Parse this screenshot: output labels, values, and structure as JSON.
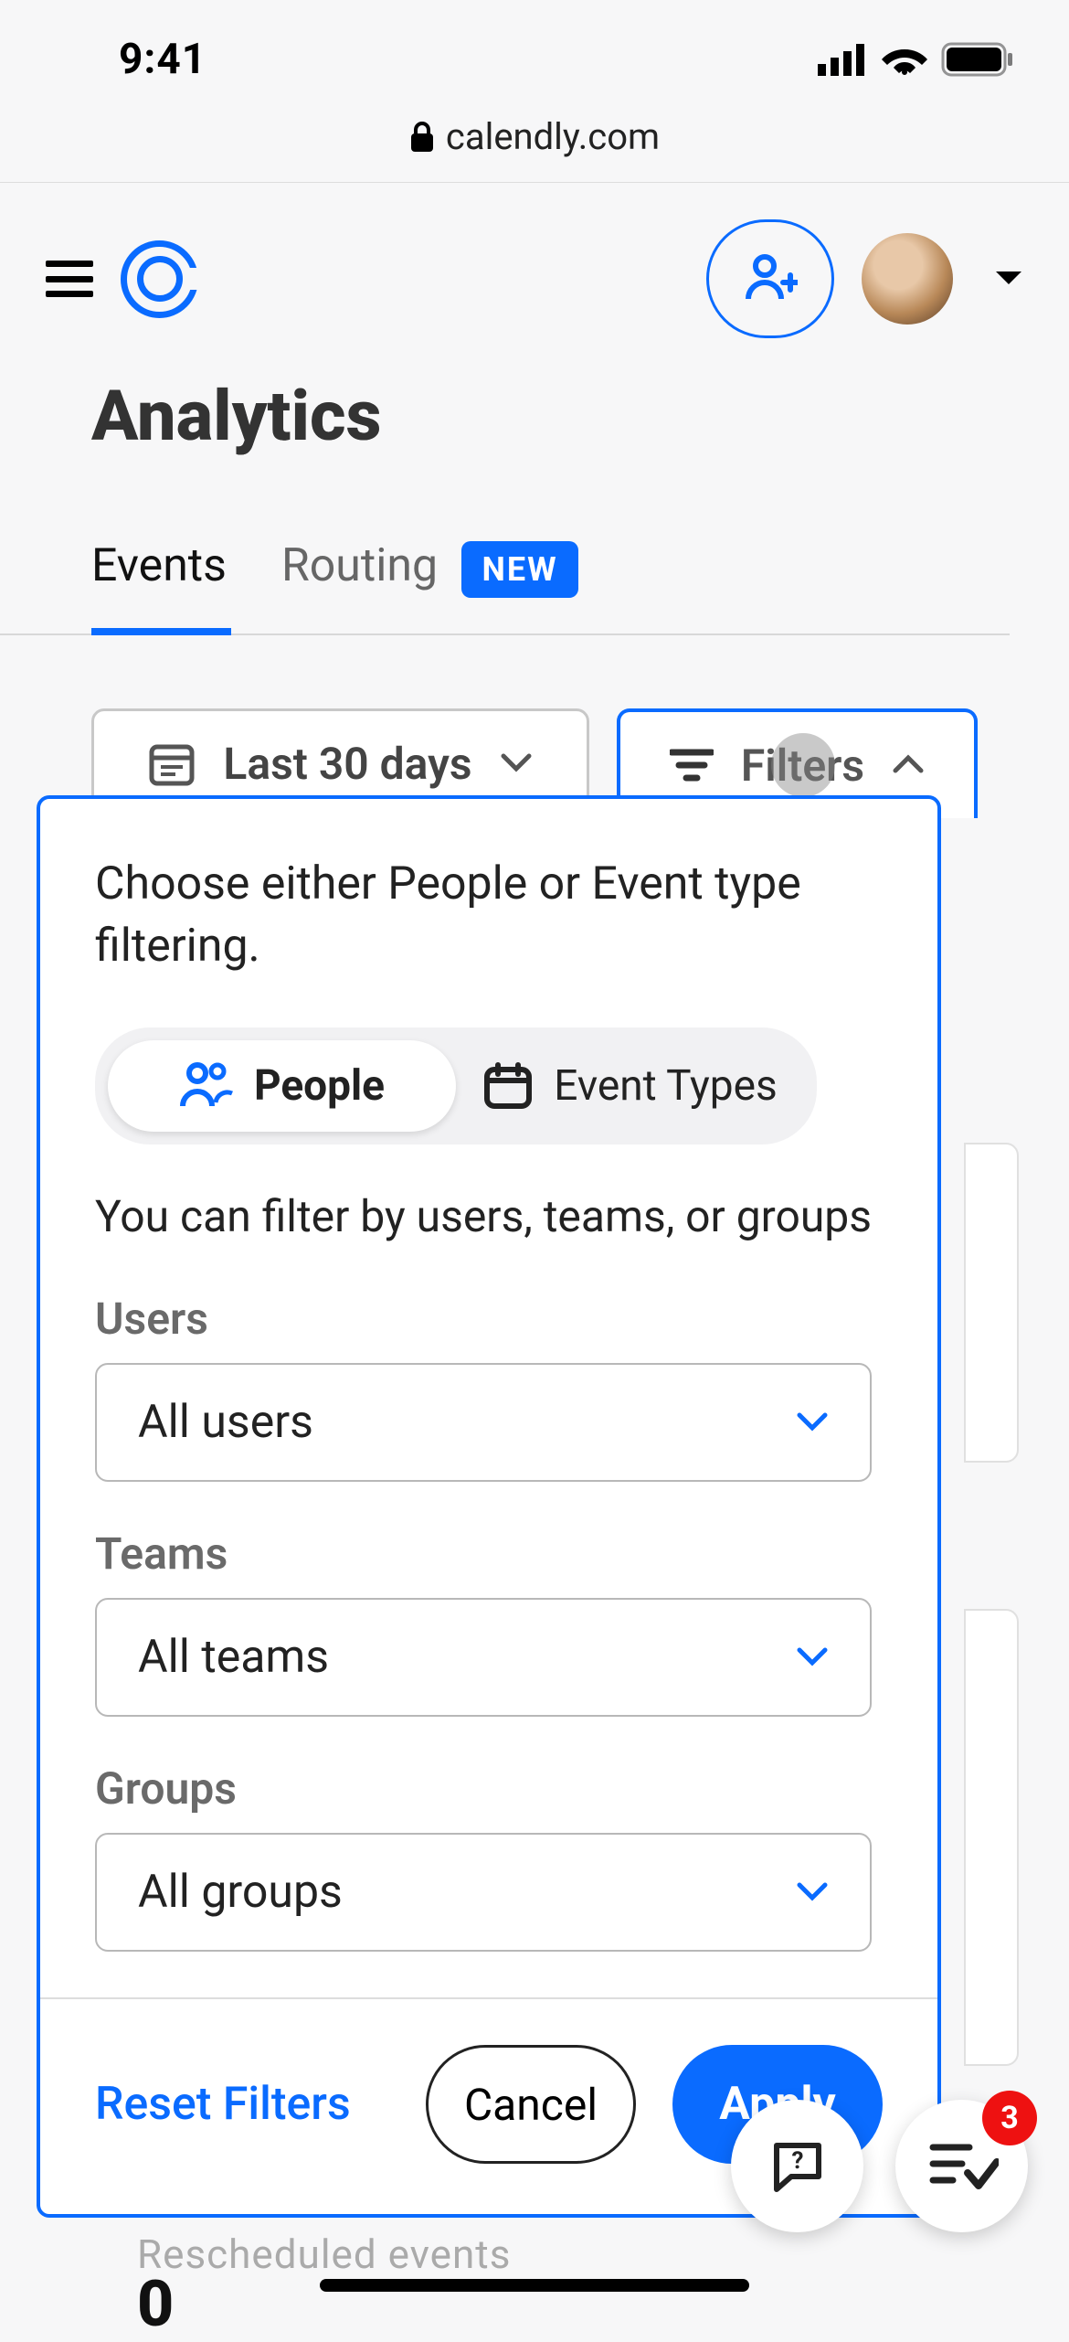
{
  "status": {
    "time": "9:41"
  },
  "url": {
    "domain": "calendly.com"
  },
  "page": {
    "title": "Analytics"
  },
  "tabs": {
    "events": "Events",
    "routing": "Routing",
    "new_badge": "NEW"
  },
  "date_filter": {
    "label": "Last 30 days"
  },
  "filters_button": {
    "label": "Filters"
  },
  "popover": {
    "heading": "Choose either People or Event type filtering.",
    "segments": {
      "people": "People",
      "event_types": "Event Types"
    },
    "subtext": "You can filter by users, teams, or groups",
    "users": {
      "label": "Users",
      "value": "All users"
    },
    "teams": {
      "label": "Teams",
      "value": "All teams"
    },
    "groups": {
      "label": "Groups",
      "value": "All groups"
    },
    "reset": "Reset Filters",
    "cancel": "Cancel",
    "apply": "Apply"
  },
  "fab": {
    "badge": "3"
  },
  "background": {
    "rescheduled": "Rescheduled events",
    "zero": "0"
  }
}
